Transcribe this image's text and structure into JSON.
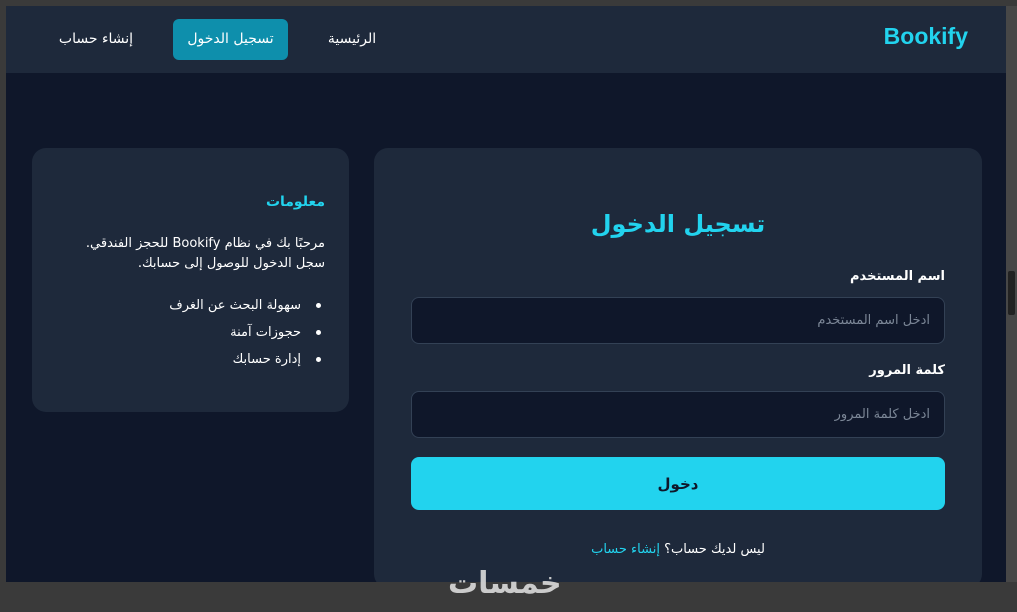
{
  "nav": {
    "brand": "Bookify",
    "links": [
      {
        "label": "الرئيسية"
      },
      {
        "label": "تسجيل الدخول"
      },
      {
        "label": "إنشاء حساب"
      }
    ]
  },
  "login": {
    "title": "تسجيل الدخول",
    "username_label": "اسم المستخدم",
    "username_placeholder": "ادخل اسم المستخدم",
    "username_value": "",
    "password_label": "كلمة المرور",
    "password_placeholder": "ادخل كلمة المرور",
    "password_value": "",
    "submit_label": "دخول",
    "no_account_text": "ليس لديك حساب؟",
    "signup_link": "إنشاء حساب"
  },
  "info": {
    "title": "معلومات",
    "text": "مرحبًا بك في نظام Bookify للحجز الفندقي. سجل الدخول للوصول إلى حسابك.",
    "items": [
      {
        "label": "سهولة البحث عن الغرف"
      },
      {
        "label": "حجوزات آمنة"
      },
      {
        "label": "إدارة حسابك"
      }
    ]
  },
  "watermark": "خمسات",
  "colors": {
    "accent": "#22d3ee",
    "active_nav": "#0e8fac",
    "page_bg": "#0f172a",
    "card_bg": "#1e293b"
  }
}
